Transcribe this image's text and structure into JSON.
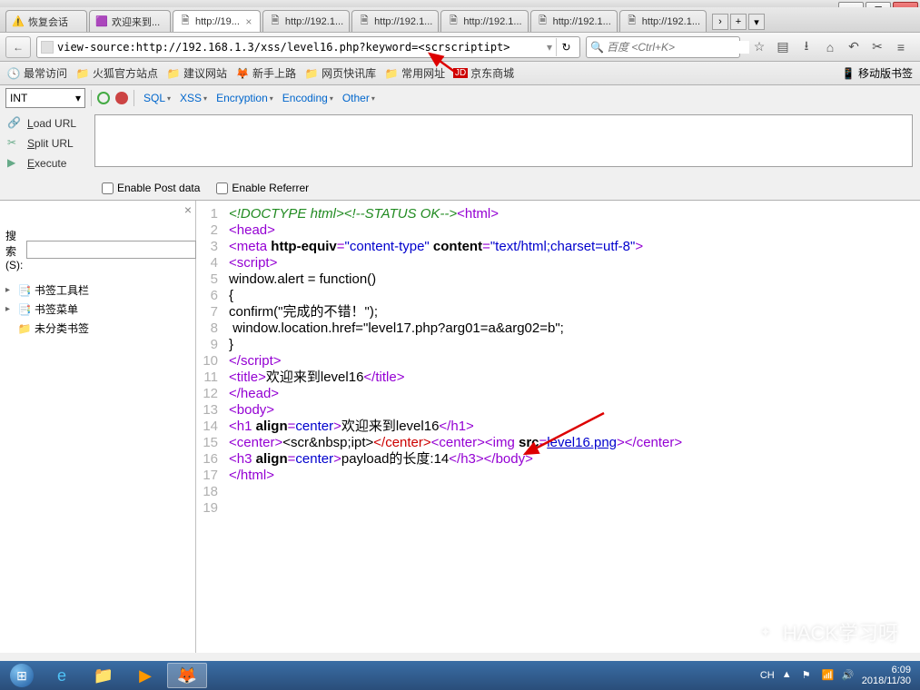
{
  "window": {
    "min": "—",
    "max": "❐",
    "close": "✕"
  },
  "tabs": [
    {
      "icon": "⚠️",
      "label": "恢复会话"
    },
    {
      "icon": "🟪",
      "label": "欢迎来到..."
    },
    {
      "icon": "",
      "label": "http://19...",
      "active": true
    },
    {
      "icon": "",
      "label": "http://192.1..."
    },
    {
      "icon": "",
      "label": "http://192.1..."
    },
    {
      "icon": "",
      "label": "http://192.1..."
    },
    {
      "icon": "",
      "label": "http://192.1..."
    },
    {
      "icon": "",
      "label": "http://192.1..."
    }
  ],
  "addr": {
    "back": "←",
    "url": "view-source:http://192.168.1.3/xss/level16.php?keyword=<scrscriptipt>",
    "reload": "↻",
    "searchPlaceholder": "百度 <Ctrl+K>",
    "icons": {
      "star": "☆",
      "list": "▤",
      "down": "⭳",
      "home": "⌂",
      "undo": "↶",
      "clip": "✂",
      "menu": "≡"
    }
  },
  "bookmarks": {
    "most": "最常访问",
    "items": [
      "火狐官方站点",
      "建议网站",
      "新手上路",
      "网页快讯库",
      "常用网址",
      "京东商城"
    ],
    "right": "移动版书签"
  },
  "hackbar": {
    "select": "INT",
    "menus": [
      "SQL",
      "XSS",
      "Encryption",
      "Encoding",
      "Other"
    ],
    "left": [
      {
        "icon": "🔗",
        "text": "Load URL",
        "u": "L"
      },
      {
        "icon": "✂",
        "text": "Split URL",
        "u": "S"
      },
      {
        "icon": "▶",
        "text": "Execute",
        "u": "E"
      }
    ],
    "checks": [
      "Enable Post data",
      "Enable Referrer"
    ]
  },
  "sidebar": {
    "searchLabel": "搜索(S):",
    "nodes": [
      {
        "icon": "📑",
        "label": "书签工具栏"
      },
      {
        "icon": "📑",
        "label": "书签菜单"
      },
      {
        "icon": "📁",
        "label": "未分类书签"
      }
    ]
  },
  "source": {
    "lines": [
      {
        "n": 1,
        "seg": [
          {
            "c": "comment",
            "t": "<!DOCTYPE html><!--STATUS OK-->"
          },
          {
            "c": "tag-b",
            "t": "<html>"
          }
        ]
      },
      {
        "n": 2,
        "seg": [
          {
            "c": "tag-b",
            "t": "<head>"
          }
        ]
      },
      {
        "n": 3,
        "seg": [
          {
            "c": "tag-b",
            "t": "<meta "
          },
          {
            "c": "attr-n",
            "t": "http-equiv"
          },
          {
            "c": "tag-b",
            "t": "="
          },
          {
            "c": "attr-v",
            "t": "\"content-type\""
          },
          {
            "c": "tag-b",
            "t": " "
          },
          {
            "c": "attr-n",
            "t": "content"
          },
          {
            "c": "tag-b",
            "t": "="
          },
          {
            "c": "attr-v",
            "t": "\"text/html;charset=utf-8\""
          },
          {
            "c": "tag-b",
            "t": ">"
          }
        ]
      },
      {
        "n": 4,
        "seg": [
          {
            "c": "tag-b",
            "t": "<script>"
          }
        ]
      },
      {
        "n": 5,
        "seg": [
          {
            "c": "text",
            "t": "window.alert = function()"
          }
        ]
      },
      {
        "n": 6,
        "seg": [
          {
            "c": "text",
            "t": "{"
          }
        ]
      },
      {
        "n": 7,
        "seg": [
          {
            "c": "text",
            "t": "confirm(\"完成的不错！\");"
          }
        ]
      },
      {
        "n": 8,
        "seg": [
          {
            "c": "text",
            "t": " window.location.href=\"level17.php?arg01=a&arg02=b\"; "
          }
        ]
      },
      {
        "n": 9,
        "seg": [
          {
            "c": "text",
            "t": "}"
          }
        ]
      },
      {
        "n": 10,
        "seg": [
          {
            "c": "tag-b",
            "t": "</"
          },
          {
            "c": "tag-b",
            "t": "script>"
          }
        ]
      },
      {
        "n": 11,
        "seg": [
          {
            "c": "tag-b",
            "t": "<title>"
          },
          {
            "c": "text",
            "t": "欢迎来到level16"
          },
          {
            "c": "tag-b",
            "t": "</title>"
          }
        ]
      },
      {
        "n": 12,
        "seg": [
          {
            "c": "tag-b",
            "t": "</head>"
          }
        ]
      },
      {
        "n": 13,
        "seg": [
          {
            "c": "tag-b",
            "t": "<body>"
          }
        ]
      },
      {
        "n": 14,
        "seg": [
          {
            "c": "tag-b",
            "t": "<h1 "
          },
          {
            "c": "attr-n",
            "t": "align"
          },
          {
            "c": "tag-b",
            "t": "="
          },
          {
            "c": "attr-v",
            "t": "center"
          },
          {
            "c": "tag-b",
            "t": ">"
          },
          {
            "c": "text",
            "t": "欢迎来到level16"
          },
          {
            "c": "tag-b",
            "t": "</h1>"
          }
        ]
      },
      {
        "n": 15,
        "seg": [
          {
            "c": "tag-b",
            "t": "<center>"
          },
          {
            "c": "text",
            "t": "<scr&nbsp;ipt>"
          },
          {
            "c": "red-close",
            "t": "</center>"
          },
          {
            "c": "tag-b",
            "t": "<center><img "
          },
          {
            "c": "attr-n",
            "t": "src"
          },
          {
            "c": "tag-b",
            "t": "="
          },
          {
            "c": "attr-v",
            "t": "level16.png",
            "link": true
          },
          {
            "c": "tag-b",
            "t": "></center>"
          }
        ]
      },
      {
        "n": 16,
        "seg": [
          {
            "c": "tag-b",
            "t": "<h3 "
          },
          {
            "c": "attr-n",
            "t": "align"
          },
          {
            "c": "tag-b",
            "t": "="
          },
          {
            "c": "attr-v",
            "t": "center"
          },
          {
            "c": "tag-b",
            "t": ">"
          },
          {
            "c": "text",
            "t": "payload的长度:14"
          },
          {
            "c": "tag-b",
            "t": "</h3></body>"
          }
        ]
      },
      {
        "n": 17,
        "seg": [
          {
            "c": "tag-b",
            "t": "</html>"
          }
        ]
      },
      {
        "n": 18,
        "seg": []
      },
      {
        "n": 19,
        "seg": []
      }
    ]
  },
  "watermark": "HACK学习呀",
  "tray": {
    "ime": "CH",
    "time": "6:09",
    "date": "2018/11/30"
  }
}
